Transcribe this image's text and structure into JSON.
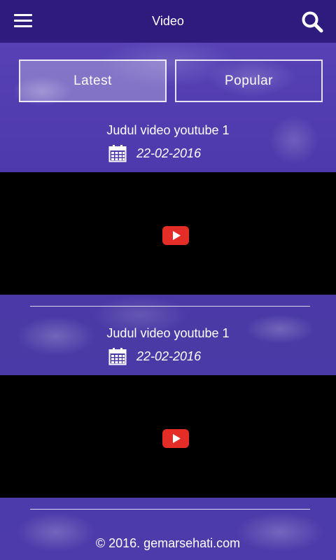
{
  "header": {
    "title": "Video",
    "menu_icon": "hamburger-menu-icon",
    "search_icon": "search-icon",
    "bar_color": "#2f1a7e"
  },
  "tabs": [
    {
      "label": "Latest",
      "active": true
    },
    {
      "label": "Popular",
      "active": false
    }
  ],
  "videos": [
    {
      "title": "Judul video youtube 1",
      "date": "22-02-2016",
      "date_icon": "calendar-icon",
      "play_icon": "youtube-play-icon"
    },
    {
      "title": "Judul video youtube 1",
      "date": "22-02-2016",
      "date_icon": "calendar-icon",
      "play_icon": "youtube-play-icon"
    }
  ],
  "footer": {
    "text": "© 2016. gemarsehati.com"
  },
  "colors": {
    "accent": "#3b2a8c",
    "youtube_red": "#e52d27"
  }
}
